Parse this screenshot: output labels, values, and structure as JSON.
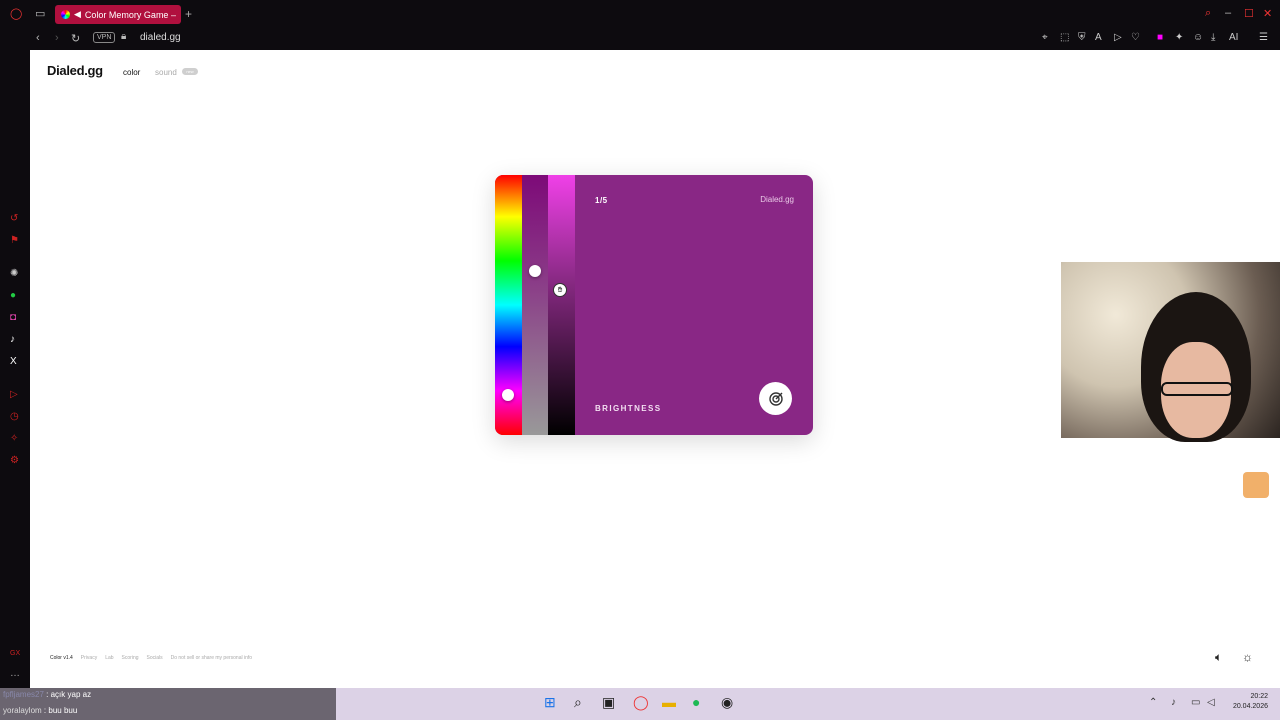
{
  "browser": {
    "tab_title": "Color Memory Game –",
    "vpn": "VPN",
    "url": "dialed.gg",
    "ai_label": "AI"
  },
  "site": {
    "logo": "Dialed.gg",
    "nav": {
      "color": "color",
      "sound": "sound",
      "new_badge": "new"
    }
  },
  "game": {
    "round": "1/5",
    "brand": "Dialed.gg",
    "label": "BRIGHTNESS",
    "color": "#892785"
  },
  "footer": {
    "items": [
      "Color v1.4",
      "Privacy",
      "Lab",
      "Scoring",
      "Socials",
      "Do not sell or share my personal info"
    ]
  },
  "chat": [
    {
      "user": "fpfljames27",
      "message": ": açık yap az"
    },
    {
      "user": "yoralaylom",
      "message": ": buu buu"
    }
  ],
  "system": {
    "time": "20:22",
    "date": "20.04.2026"
  }
}
